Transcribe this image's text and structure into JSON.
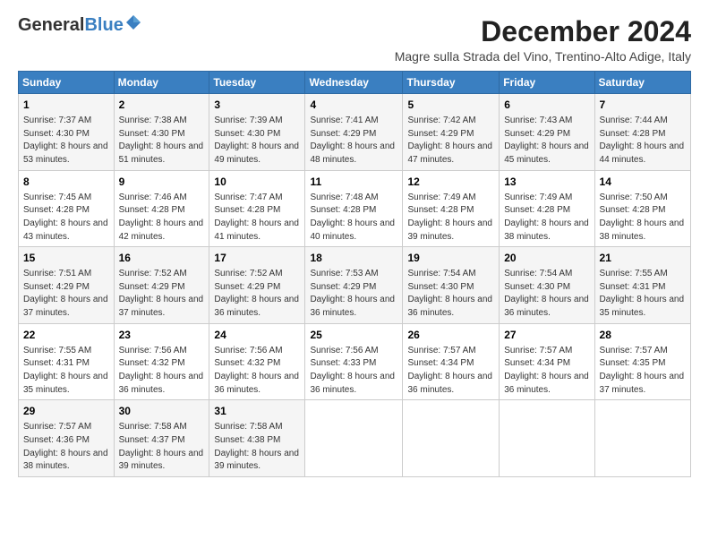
{
  "header": {
    "logo_general": "General",
    "logo_blue": "Blue",
    "title": "December 2024",
    "subtitle": "Magre sulla Strada del Vino, Trentino-Alto Adige, Italy"
  },
  "calendar": {
    "days_of_week": [
      "Sunday",
      "Monday",
      "Tuesday",
      "Wednesday",
      "Thursday",
      "Friday",
      "Saturday"
    ],
    "weeks": [
      [
        {
          "day": "1",
          "sunrise": "Sunrise: 7:37 AM",
          "sunset": "Sunset: 4:30 PM",
          "daylight": "Daylight: 8 hours and 53 minutes."
        },
        {
          "day": "2",
          "sunrise": "Sunrise: 7:38 AM",
          "sunset": "Sunset: 4:30 PM",
          "daylight": "Daylight: 8 hours and 51 minutes."
        },
        {
          "day": "3",
          "sunrise": "Sunrise: 7:39 AM",
          "sunset": "Sunset: 4:30 PM",
          "daylight": "Daylight: 8 hours and 49 minutes."
        },
        {
          "day": "4",
          "sunrise": "Sunrise: 7:41 AM",
          "sunset": "Sunset: 4:29 PM",
          "daylight": "Daylight: 8 hours and 48 minutes."
        },
        {
          "day": "5",
          "sunrise": "Sunrise: 7:42 AM",
          "sunset": "Sunset: 4:29 PM",
          "daylight": "Daylight: 8 hours and 47 minutes."
        },
        {
          "day": "6",
          "sunrise": "Sunrise: 7:43 AM",
          "sunset": "Sunset: 4:29 PM",
          "daylight": "Daylight: 8 hours and 45 minutes."
        },
        {
          "day": "7",
          "sunrise": "Sunrise: 7:44 AM",
          "sunset": "Sunset: 4:28 PM",
          "daylight": "Daylight: 8 hours and 44 minutes."
        }
      ],
      [
        {
          "day": "8",
          "sunrise": "Sunrise: 7:45 AM",
          "sunset": "Sunset: 4:28 PM",
          "daylight": "Daylight: 8 hours and 43 minutes."
        },
        {
          "day": "9",
          "sunrise": "Sunrise: 7:46 AM",
          "sunset": "Sunset: 4:28 PM",
          "daylight": "Daylight: 8 hours and 42 minutes."
        },
        {
          "day": "10",
          "sunrise": "Sunrise: 7:47 AM",
          "sunset": "Sunset: 4:28 PM",
          "daylight": "Daylight: 8 hours and 41 minutes."
        },
        {
          "day": "11",
          "sunrise": "Sunrise: 7:48 AM",
          "sunset": "Sunset: 4:28 PM",
          "daylight": "Daylight: 8 hours and 40 minutes."
        },
        {
          "day": "12",
          "sunrise": "Sunrise: 7:49 AM",
          "sunset": "Sunset: 4:28 PM",
          "daylight": "Daylight: 8 hours and 39 minutes."
        },
        {
          "day": "13",
          "sunrise": "Sunrise: 7:49 AM",
          "sunset": "Sunset: 4:28 PM",
          "daylight": "Daylight: 8 hours and 38 minutes."
        },
        {
          "day": "14",
          "sunrise": "Sunrise: 7:50 AM",
          "sunset": "Sunset: 4:28 PM",
          "daylight": "Daylight: 8 hours and 38 minutes."
        }
      ],
      [
        {
          "day": "15",
          "sunrise": "Sunrise: 7:51 AM",
          "sunset": "Sunset: 4:29 PM",
          "daylight": "Daylight: 8 hours and 37 minutes."
        },
        {
          "day": "16",
          "sunrise": "Sunrise: 7:52 AM",
          "sunset": "Sunset: 4:29 PM",
          "daylight": "Daylight: 8 hours and 37 minutes."
        },
        {
          "day": "17",
          "sunrise": "Sunrise: 7:52 AM",
          "sunset": "Sunset: 4:29 PM",
          "daylight": "Daylight: 8 hours and 36 minutes."
        },
        {
          "day": "18",
          "sunrise": "Sunrise: 7:53 AM",
          "sunset": "Sunset: 4:29 PM",
          "daylight": "Daylight: 8 hours and 36 minutes."
        },
        {
          "day": "19",
          "sunrise": "Sunrise: 7:54 AM",
          "sunset": "Sunset: 4:30 PM",
          "daylight": "Daylight: 8 hours and 36 minutes."
        },
        {
          "day": "20",
          "sunrise": "Sunrise: 7:54 AM",
          "sunset": "Sunset: 4:30 PM",
          "daylight": "Daylight: 8 hours and 36 minutes."
        },
        {
          "day": "21",
          "sunrise": "Sunrise: 7:55 AM",
          "sunset": "Sunset: 4:31 PM",
          "daylight": "Daylight: 8 hours and 35 minutes."
        }
      ],
      [
        {
          "day": "22",
          "sunrise": "Sunrise: 7:55 AM",
          "sunset": "Sunset: 4:31 PM",
          "daylight": "Daylight: 8 hours and 35 minutes."
        },
        {
          "day": "23",
          "sunrise": "Sunrise: 7:56 AM",
          "sunset": "Sunset: 4:32 PM",
          "daylight": "Daylight: 8 hours and 36 minutes."
        },
        {
          "day": "24",
          "sunrise": "Sunrise: 7:56 AM",
          "sunset": "Sunset: 4:32 PM",
          "daylight": "Daylight: 8 hours and 36 minutes."
        },
        {
          "day": "25",
          "sunrise": "Sunrise: 7:56 AM",
          "sunset": "Sunset: 4:33 PM",
          "daylight": "Daylight: 8 hours and 36 minutes."
        },
        {
          "day": "26",
          "sunrise": "Sunrise: 7:57 AM",
          "sunset": "Sunset: 4:34 PM",
          "daylight": "Daylight: 8 hours and 36 minutes."
        },
        {
          "day": "27",
          "sunrise": "Sunrise: 7:57 AM",
          "sunset": "Sunset: 4:34 PM",
          "daylight": "Daylight: 8 hours and 36 minutes."
        },
        {
          "day": "28",
          "sunrise": "Sunrise: 7:57 AM",
          "sunset": "Sunset: 4:35 PM",
          "daylight": "Daylight: 8 hours and 37 minutes."
        }
      ],
      [
        {
          "day": "29",
          "sunrise": "Sunrise: 7:57 AM",
          "sunset": "Sunset: 4:36 PM",
          "daylight": "Daylight: 8 hours and 38 minutes."
        },
        {
          "day": "30",
          "sunrise": "Sunrise: 7:58 AM",
          "sunset": "Sunset: 4:37 PM",
          "daylight": "Daylight: 8 hours and 39 minutes."
        },
        {
          "day": "31",
          "sunrise": "Sunrise: 7:58 AM",
          "sunset": "Sunset: 4:38 PM",
          "daylight": "Daylight: 8 hours and 39 minutes."
        },
        null,
        null,
        null,
        null
      ]
    ]
  }
}
